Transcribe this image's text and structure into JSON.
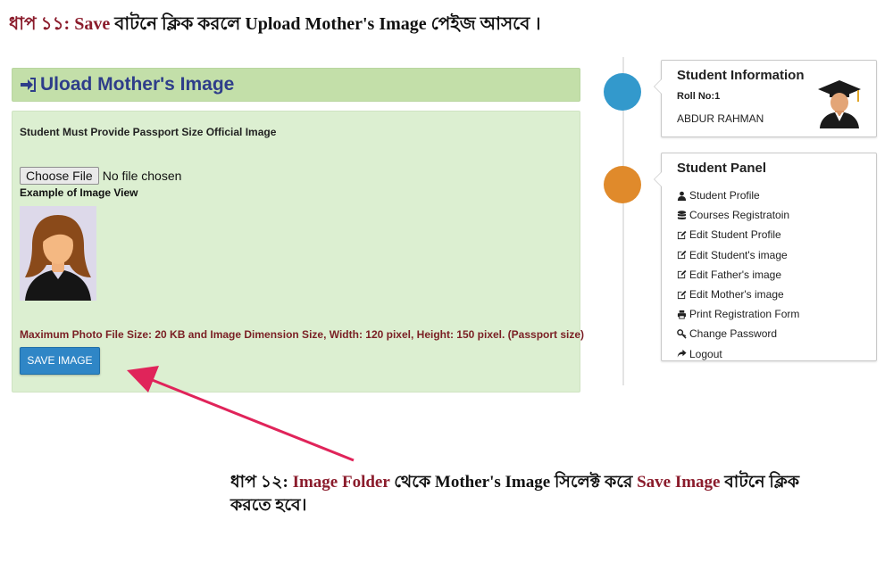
{
  "instructions": {
    "top": {
      "step": "ধাপ ১১:",
      "kw_save": "Save",
      "mid": "বাটনে ক্লিক করলে",
      "kw_page": "Upload Mother's Image",
      "tail": "পেইজ আসবে ।"
    },
    "bottom": {
      "step": "ধাপ ১২:",
      "kw_folder": "Image Folder",
      "mid1": "থেকে",
      "kw_mother": "Mother's Image",
      "mid2": "সিলেক্ট করে",
      "kw_save": "Save Image",
      "tail": "বাটনে ক্লিক করতে হবে।"
    }
  },
  "upload_panel": {
    "title": "Uload Mother's Image",
    "requirement": "Student Must Provide Passport Size Official Image",
    "file_input": {
      "button_label": "Choose File",
      "status": "No file chosen"
    },
    "example_label": "Example of Image View",
    "limit_note": "Maximum Photo File Size: 20 KB and Image Dimension Size, Width: 120 pixel, Height: 150 pixel. (Passport size)",
    "save_button": "SAVE IMAGE"
  },
  "student_info": {
    "title": "Student Information",
    "roll": "Roll No:1",
    "name": "ABDUR RAHMAN"
  },
  "student_panel": {
    "title": "Student Panel",
    "items": [
      {
        "label": "Student Profile",
        "icon": "user-icon"
      },
      {
        "label": "Courses Registratoin",
        "icon": "database-icon"
      },
      {
        "label": "Edit Student Profile",
        "icon": "edit-icon"
      },
      {
        "label": "Edit Student's image",
        "icon": "edit-icon"
      },
      {
        "label": "Edit Father's image",
        "icon": "edit-icon"
      },
      {
        "label": "Edit Mother's image",
        "icon": "edit-icon"
      },
      {
        "label": "Print Registration Form",
        "icon": "print-icon"
      },
      {
        "label": "Change Password",
        "icon": "key-icon"
      },
      {
        "label": "Logout",
        "icon": "share-icon"
      }
    ]
  },
  "colors": {
    "header_bg": "#c3dfa9",
    "panel_bg": "#dcefd1",
    "title_blue": "#2e3d8a",
    "button_blue": "#2f86c6",
    "accent_red": "#8b1c2c",
    "arrow": "#e0245a",
    "dot_blue": "#3399cc",
    "dot_orange": "#e08a2b"
  }
}
